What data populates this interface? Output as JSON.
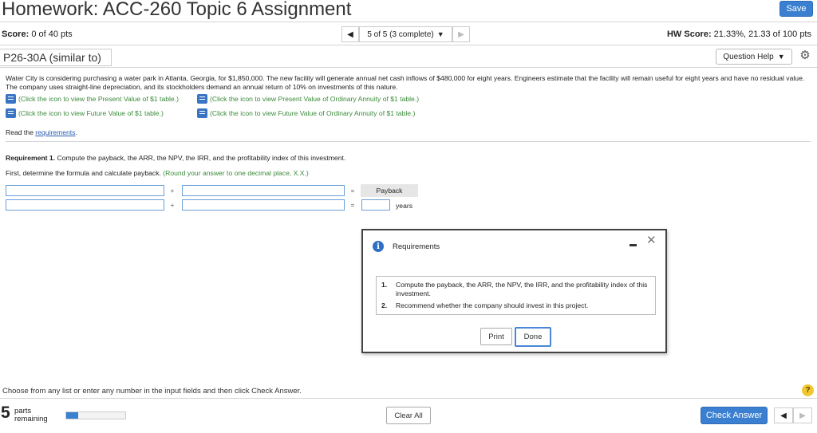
{
  "header": {
    "title": "Homework: ACC-260 Topic 6 Assignment",
    "save_label": "Save"
  },
  "scorebar": {
    "score_label": "Score:",
    "score_value": "0 of 40 pts",
    "question_position": "5 of 5 (3 complete)",
    "hw_score_label": "HW Score:",
    "hw_score_value": "21.33%, 21.33 of 100 pts"
  },
  "question": {
    "id_label": "P26-30A (similar to)",
    "help_label": "Question Help"
  },
  "problem": {
    "text": "Water City is considering purchasing a water park in Atlanta, Georgia, for $1,850,000. The new facility will generate annual net cash inflows of $480,000 for eight years. Engineers estimate that the facility will remain useful for eight years and have no residual value. The company uses straight-line depreciation, and its stockholders demand an annual return of 10% on investments of this nature.",
    "links": [
      "(Click the icon to view the Present Value of $1 table.)",
      "(Click the icon to view Present Value of Ordinary Annuity of $1 table.)",
      "(Click the icon to view Future Value of $1 table.)",
      "(Click the icon to view Future Value of Ordinary Annuity of $1 table.)"
    ],
    "read_prefix": "Read the",
    "read_link": "requirements",
    "read_suffix": "."
  },
  "requirement1": {
    "label": "Requirement 1.",
    "text": "Compute the payback, the ARR, the NPV, the IRR, and the profitability index of this investment.",
    "instruction": "First, determine the formula and calculate payback.",
    "hint": "(Round your answer to one decimal place, X.X.)",
    "row1_op": "+",
    "row1_eq": "=",
    "row1_result": "Payback",
    "row2_op": "+",
    "row2_eq": "=",
    "row2_unit": "years",
    "inputs": {
      "r1a": "",
      "r1b": "",
      "r2a": "",
      "r2b": "",
      "r2result": ""
    }
  },
  "modal": {
    "title": "Requirements",
    "items": [
      {
        "num": "1.",
        "text": "Compute the payback, the ARR, the NPV, the IRR, and the profitability index of this investment."
      },
      {
        "num": "2.",
        "text": "Recommend whether the company should invest in this project."
      }
    ],
    "print_label": "Print",
    "done_label": "Done"
  },
  "footer": {
    "instruction": "Choose from any list or enter any number in the input fields and then click Check Answer.",
    "parts_count": "5",
    "parts_label_1": "parts",
    "parts_label_2": "remaining",
    "progress_fraction": 0.2,
    "clear_all_label": "Clear All",
    "check_answer_label": "Check Answer",
    "help_glyph": "?"
  },
  "colors": {
    "accent_blue": "#3a7fd0",
    "hint_green": "#3a8a3a",
    "link_blue": "#2a5db0",
    "help_yellow": "#f2c62f"
  }
}
